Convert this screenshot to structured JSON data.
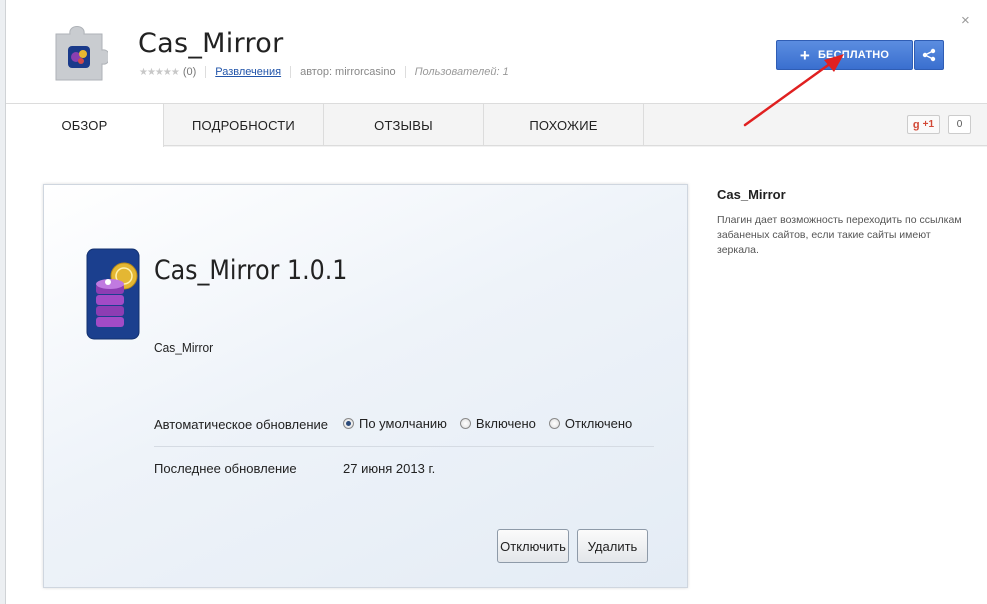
{
  "header": {
    "title": "Cas_Mirror",
    "rating_stars": "★★★★★",
    "rating_count": "(0)",
    "category": "Развлечения",
    "author": "автор: mirrorcasino",
    "users": "Пользователей: 1",
    "close_label": "×",
    "free_button": "БЕСПЛАТНО",
    "free_button_icon": "+"
  },
  "tabs": [
    {
      "label": "ОБЗОР"
    },
    {
      "label": "ПОДРОБНОСТИ"
    },
    {
      "label": "ОТЗЫВЫ"
    },
    {
      "label": "ПОХОЖИЕ"
    }
  ],
  "social": {
    "gplus_g": "g",
    "gplus_label": "+1",
    "count": "0"
  },
  "screenshot": {
    "title": "Cas_Mirror 1.0.1",
    "subtitle": "Cas_Mirror",
    "auto_update_label": "Автоматическое обновление",
    "options": [
      "По умолчанию",
      "Включено",
      "Отключено"
    ],
    "selected_option": "По умолчанию",
    "last_update_label": "Последнее обновление",
    "last_update_value": "27 июня 2013 г.",
    "disable_button": "Отключить",
    "remove_button": "Удалить"
  },
  "sidebar": {
    "title": "Cas_Mirror",
    "description": "Плагин дает возможность переходить по ссылкам забаненых сайтов, если такие сайты имеют зеркала."
  },
  "colors": {
    "accent": "#3a6fcf",
    "annotation_arrow": "#e02020"
  }
}
